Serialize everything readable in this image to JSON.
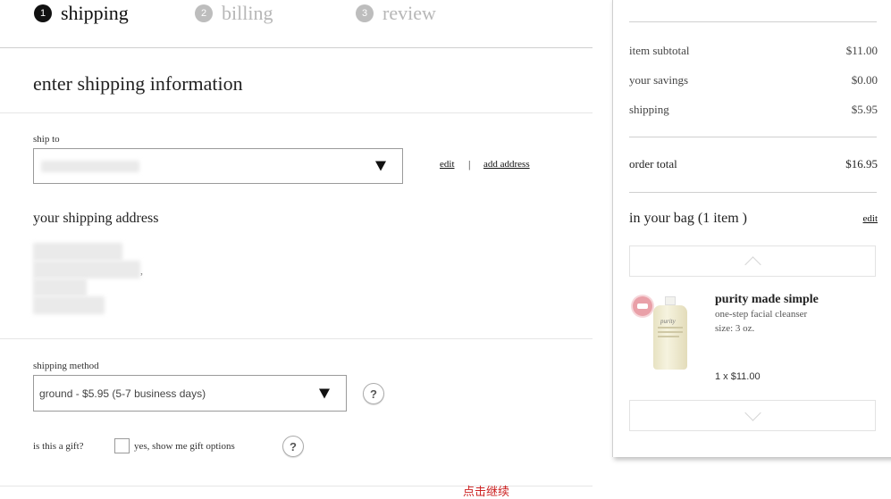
{
  "steps": [
    {
      "num": "1",
      "label": "shipping"
    },
    {
      "num": "2",
      "label": "billing"
    },
    {
      "num": "3",
      "label": "review"
    }
  ],
  "main": {
    "heading": "enter shipping information",
    "ship_to_label": "ship to",
    "edit_link": "edit",
    "separator": "|",
    "add_address_link": "add address",
    "address_heading": "your shipping address",
    "address_comma": ",",
    "shipping_method_label": "shipping method",
    "shipping_method_value": "ground - $5.95 (5-7 business days)",
    "help_icon": "?",
    "gift_label": "is this a gift?",
    "gift_option": "yes, show me gift options",
    "continue_note": "点击继续"
  },
  "summary": {
    "item_subtotal_label": "item subtotal",
    "item_subtotal_value": "$11.00",
    "savings_label": "your savings",
    "savings_value": "$0.00",
    "shipping_label": "shipping",
    "shipping_value": "$5.95",
    "order_total_label": "order total",
    "order_total_value": "$16.95",
    "bag_label": "in your bag (1 item )",
    "bag_edit": "edit",
    "product": {
      "name": "purity made simple",
      "desc": "one-step facial cleanser",
      "size": "size: 3 oz.",
      "qty_price": "1 x $11.00",
      "bottle_label": "purity"
    }
  },
  "colors": {
    "accent_note": "#cc2222",
    "step_inactive": "#b7b7b7"
  }
}
